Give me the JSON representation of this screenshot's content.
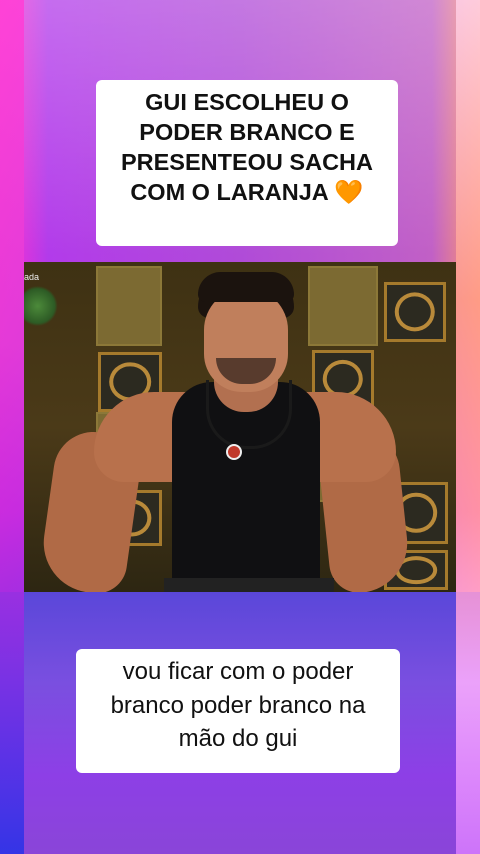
{
  "top_caption": {
    "lines": [
      "GUI ESCOLHEU O",
      "PODER BRANCO E",
      "PRESENTEOU SACHA",
      "COM O LARANJA 🧡"
    ]
  },
  "bottom_caption": {
    "lines": [
      "vou ficar com o poder",
      "branco poder branco na",
      "mão do gui"
    ]
  },
  "photo": {
    "corner_tag": "ada"
  }
}
